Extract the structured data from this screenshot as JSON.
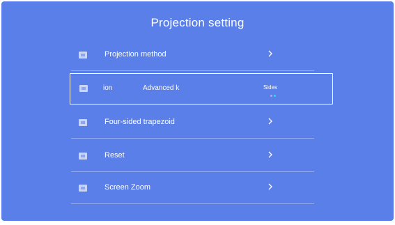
{
  "title": "Projection setting",
  "menu": {
    "projection_method": "Projection method",
    "focused": {
      "left_text": "ion",
      "middle_text": "Advanced k",
      "right_text": "Sides"
    },
    "four_sided": "Four-sided trapezoid",
    "reset": "Reset",
    "screen_zoom": "Screen Zoom"
  },
  "colors": {
    "background": "#5b7fe8",
    "dot_active": "#35d6f5",
    "dot_inactive": "#9fb4f3"
  }
}
